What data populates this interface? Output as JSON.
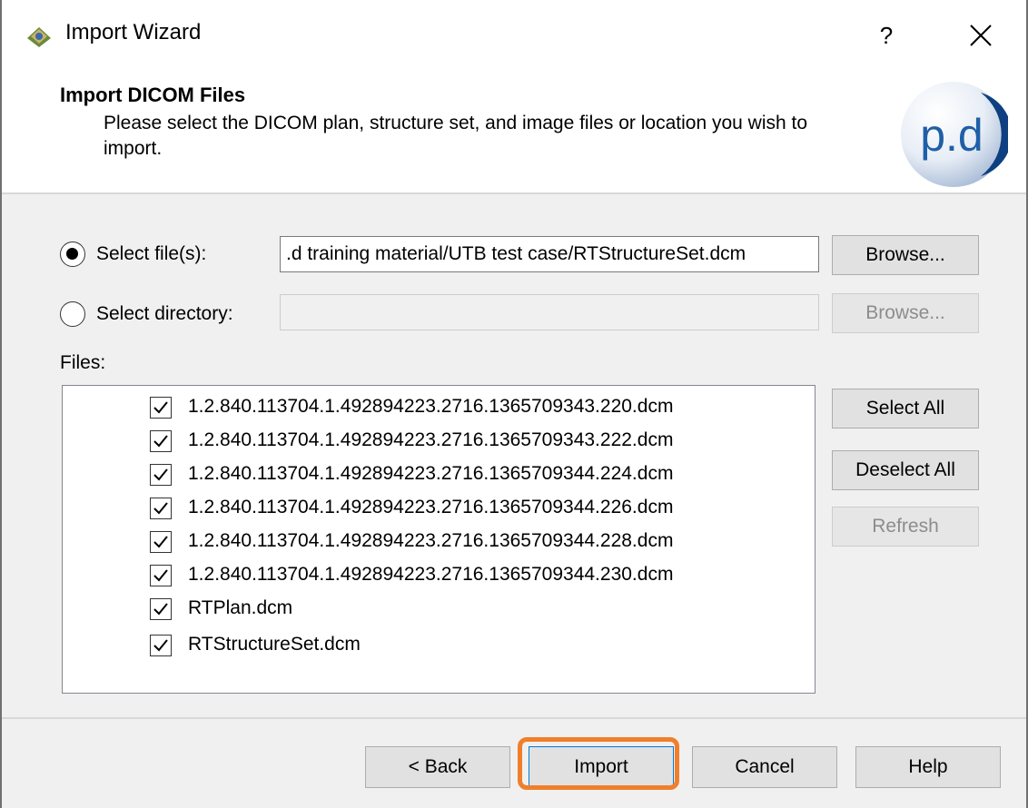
{
  "window": {
    "title": "Import Wizard",
    "help_glyph": "?",
    "close_glyph": "✕",
    "app_icon": "import-wizard-icon"
  },
  "header": {
    "title": "Import DICOM Files",
    "description": "Please select the DICOM plan, structure set, and image files or location you wish to import.",
    "logo_text": "p.d"
  },
  "source": {
    "files_option": {
      "label": "Select file(s):",
      "selected": true
    },
    "files_path": ".d training material/UTB test case/RTStructureSet.dcm",
    "files_browse": "Browse...",
    "dir_option": {
      "label": "Select directory:",
      "selected": false
    },
    "dir_path": "",
    "dir_browse": "Browse..."
  },
  "files": {
    "label": "Files:",
    "items": [
      {
        "name": "1.2.840.113704.1.492894223.2716.1365709343.220.dcm",
        "checked": true
      },
      {
        "name": "1.2.840.113704.1.492894223.2716.1365709343.222.dcm",
        "checked": true
      },
      {
        "name": "1.2.840.113704.1.492894223.2716.1365709344.224.dcm",
        "checked": true
      },
      {
        "name": "1.2.840.113704.1.492894223.2716.1365709344.226.dcm",
        "checked": true
      },
      {
        "name": "1.2.840.113704.1.492894223.2716.1365709344.228.dcm",
        "checked": true
      },
      {
        "name": "1.2.840.113704.1.492894223.2716.1365709344.230.dcm",
        "checked": true
      },
      {
        "name": "RTPlan.dcm",
        "checked": true
      },
      {
        "name": "RTStructureSet.dcm",
        "checked": true
      }
    ],
    "select_all": "Select All",
    "deselect_all": "Deselect All",
    "refresh": "Refresh"
  },
  "footer": {
    "back": "< Back",
    "import": "Import",
    "cancel": "Cancel",
    "help": "Help"
  },
  "colors": {
    "highlight": "#f07f2c",
    "logo_blue": "#1f5fa8"
  }
}
